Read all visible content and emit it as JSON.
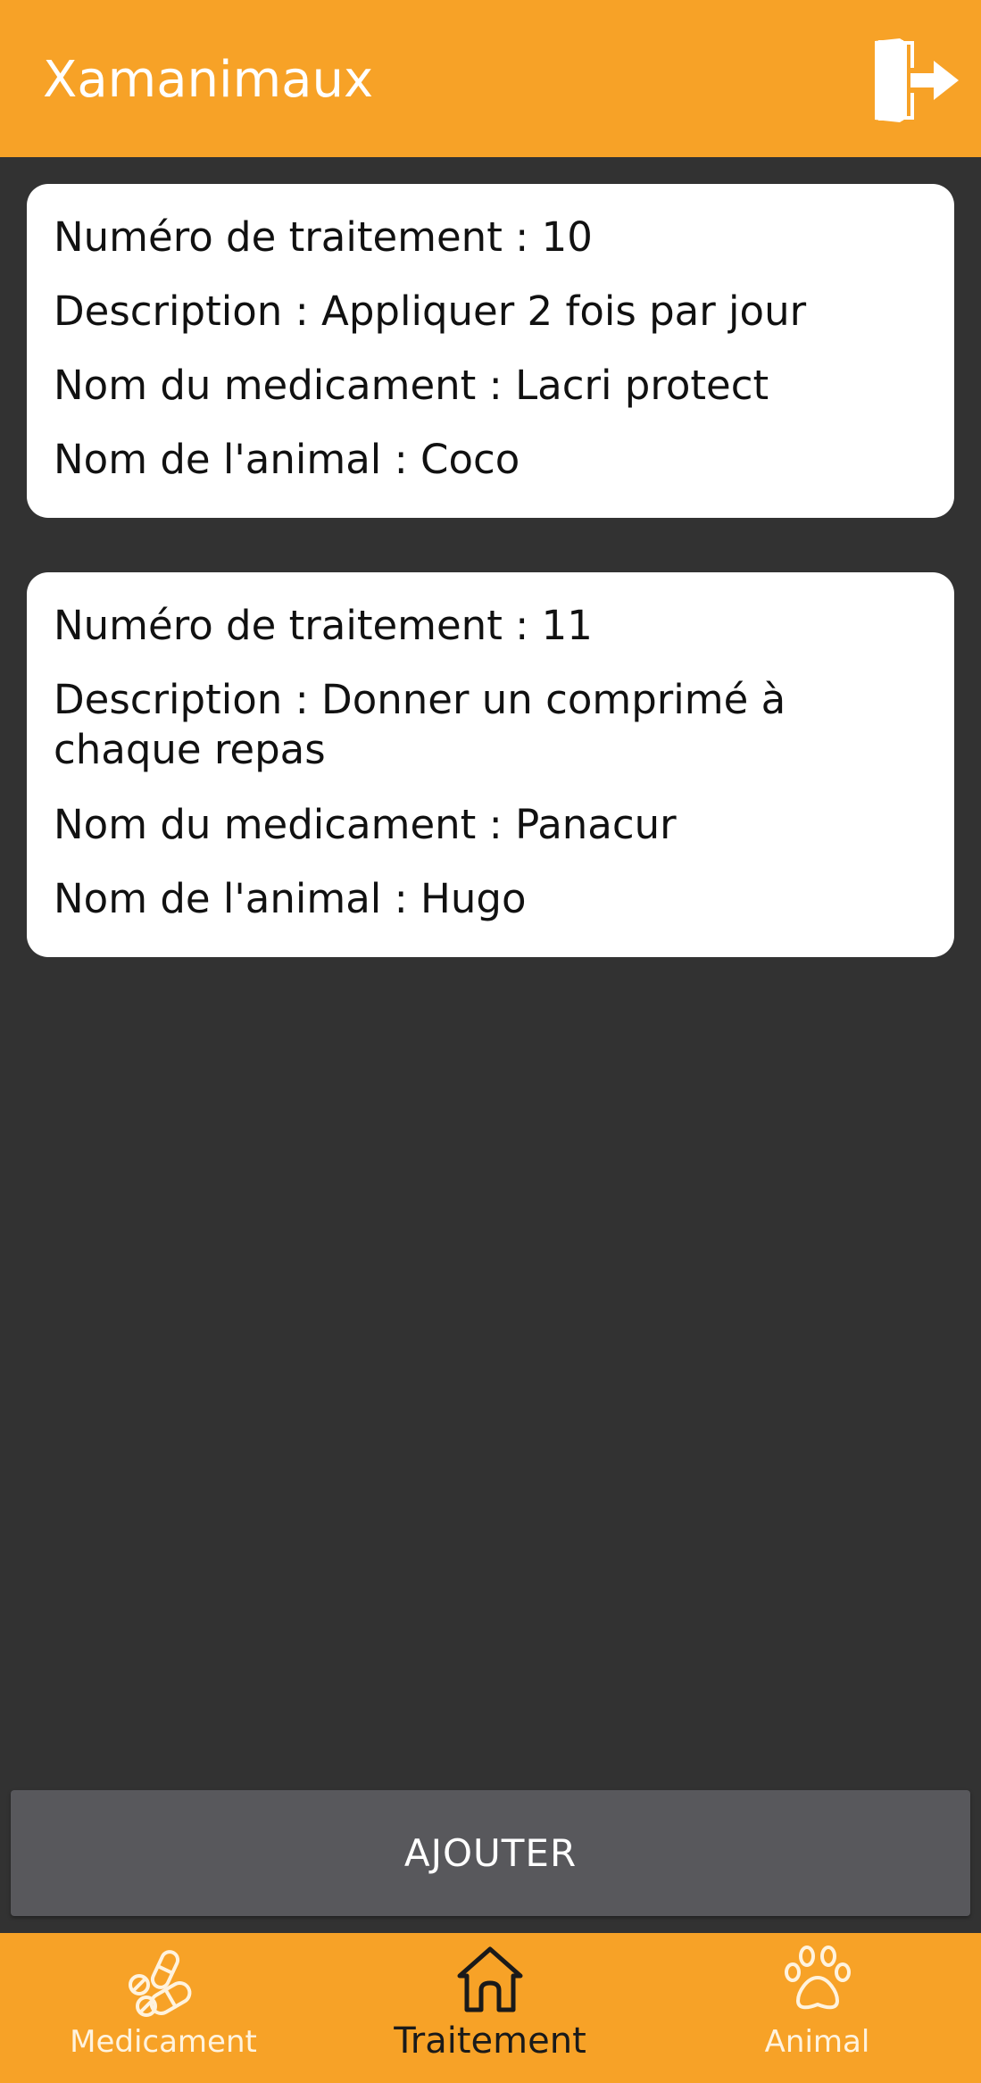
{
  "app": {
    "title": "Xamanimaux",
    "brand_color": "#f7a227",
    "background_color": "#323232",
    "logout_icon": "logout-door-icon"
  },
  "treatments": [
    {
      "numero": "Numéro de traitement : 10",
      "description": "Description : Appliquer 2 fois par jour",
      "medicament": "Nom du medicament : Lacri protect",
      "animal": "Nom de l'animal : Coco"
    },
    {
      "numero": "Numéro de traitement : 11",
      "description": "Description : Donner un comprimé à chaque repas",
      "medicament": "Nom du medicament : Panacur",
      "animal": "Nom de l'animal : Hugo"
    }
  ],
  "actions": {
    "add_label": "AJOUTER"
  },
  "bottom_nav": {
    "items": [
      {
        "label": "Medicament",
        "icon": "pills-icon",
        "active": false
      },
      {
        "label": "Traitement",
        "icon": "home-icon",
        "active": true
      },
      {
        "label": "Animal",
        "icon": "paw-icon",
        "active": false
      }
    ]
  }
}
